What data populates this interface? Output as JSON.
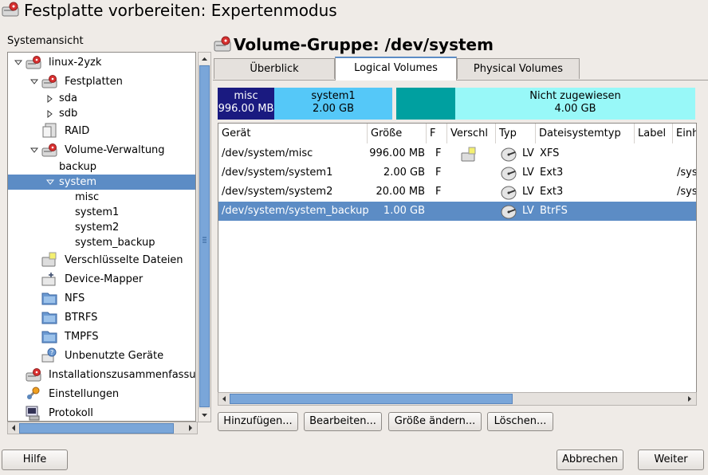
{
  "window": {
    "title": "Festplatte vorbereiten: Expertenmodus"
  },
  "sidebar": {
    "label": "Systemansicht",
    "tree": [
      {
        "label": "linux-2yzk",
        "icon": "disk-icon"
      },
      {
        "label": "Festplatten",
        "icon": "disk-icon"
      },
      {
        "label": "sda"
      },
      {
        "label": "sdb"
      },
      {
        "label": "RAID",
        "icon": "raid-icon"
      },
      {
        "label": "Volume-Verwaltung",
        "icon": "disk-icon"
      },
      {
        "label": "backup"
      },
      {
        "label": "system",
        "selected": true
      },
      {
        "label": "misc"
      },
      {
        "label": "system1"
      },
      {
        "label": "system2"
      },
      {
        "label": "system_backup"
      },
      {
        "label": "Verschlüsselte Dateien",
        "icon": "crypt-icon"
      },
      {
        "label": "Device-Mapper",
        "icon": "device-mapper-icon"
      },
      {
        "label": "NFS",
        "icon": "folder-icon"
      },
      {
        "label": "BTRFS",
        "icon": "folder-icon"
      },
      {
        "label": "TMPFS",
        "icon": "folder-icon"
      },
      {
        "label": "Unbenutzte Geräte",
        "icon": "unused-icon"
      },
      {
        "label": "Installationszusammenfassung",
        "icon": "disk-icon"
      },
      {
        "label": "Einstellungen",
        "icon": "settings-icon"
      },
      {
        "label": "Protokoll",
        "icon": "log-icon"
      }
    ]
  },
  "main": {
    "title": "Volume-Gruppe: /dev/system",
    "tabs": [
      {
        "label": "Überblick"
      },
      {
        "label": "Logical Volumes",
        "active": true
      },
      {
        "label": "Physical Volumes"
      }
    ],
    "bar": [
      {
        "name": "misc",
        "size": "996.00 MB",
        "color": "#1a1a80",
        "text_color": "#ffffff"
      },
      {
        "name": "system1",
        "size": "2.00 GB",
        "color": "#55c8f8",
        "text_color": "#000000"
      },
      {
        "name": "",
        "size": "",
        "color": "#00a0a0",
        "text_color": "#000000"
      },
      {
        "name": "Nicht zugewiesen",
        "size": "4.00 GB",
        "color": "#98f8f8",
        "text_color": "#000000"
      }
    ],
    "columns": [
      "Gerät",
      "Größe",
      "F",
      "Verschl",
      "Typ",
      "Dateisystemtyp",
      "Label",
      "Einh"
    ],
    "rows": [
      {
        "device": "/dev/system/misc",
        "size": "996.00 MB",
        "f": "F",
        "encrypted": true,
        "type": "LV",
        "fs": "XFS",
        "label": "",
        "mount": ""
      },
      {
        "device": "/dev/system/system1",
        "size": "2.00 GB",
        "f": "F",
        "encrypted": false,
        "type": "LV",
        "fs": "Ext3",
        "label": "",
        "mount": "/sys"
      },
      {
        "device": "/dev/system/system2",
        "size": "20.00 MB",
        "f": "F",
        "encrypted": false,
        "type": "LV",
        "fs": "Ext3",
        "label": "",
        "mount": "/sys"
      },
      {
        "device": "/dev/system/system_backup",
        "size": "1.00 GB",
        "f": "",
        "encrypted": false,
        "type": "LV",
        "fs": "BtrFS",
        "label": "",
        "mount": "",
        "selected": true
      }
    ],
    "buttons": {
      "add": "Hinzufügen...",
      "edit": "Bearbeiten...",
      "resize": "Größe ändern...",
      "delete": "Löschen..."
    }
  },
  "footer": {
    "help": "Hilfe",
    "abort": "Abbrechen",
    "next": "Weiter"
  },
  "colors": {
    "selection": "#5c8cc5",
    "scroll_thumb": "#7aa6d9"
  }
}
